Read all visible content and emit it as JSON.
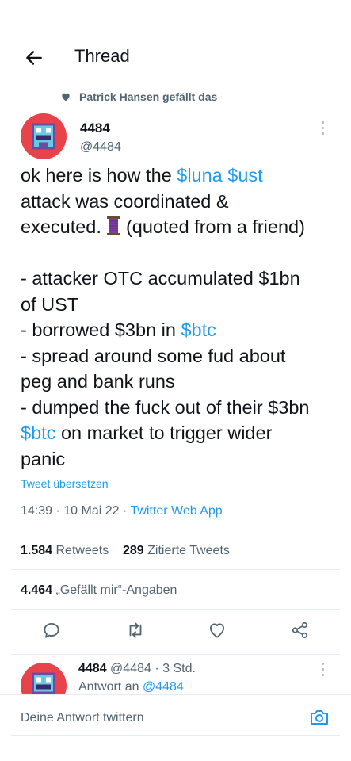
{
  "header": {
    "title": "Thread",
    "back_icon": "arrow-left-icon"
  },
  "social_context": {
    "text": "Patrick Hansen gefällt das",
    "icon": "heart-icon"
  },
  "tweet": {
    "author_name": "4484",
    "author_handle": "@4484",
    "text_segments": [
      "ok here is how the ",
      "$luna",
      " ",
      "$ust",
      "\nattack was coordinated &\nexecuted. ",
      " (quoted from a friend)\n\n- attacker OTC accumulated $1bn\nof UST\n- borrowed $3bn in ",
      "$btc",
      "\n- spread around some fud about\npeg and bank runs\n- dumped the fuck out of their $3bn\n",
      "$btc",
      " on market to trigger wider\npanic"
    ],
    "translate_label": "Tweet übersetzen",
    "time": "14:39",
    "date": "10 Mai 22",
    "source": "Twitter Web App",
    "retweets_count": "1.584",
    "retweets_label": "Retweets",
    "quotes_count": "289",
    "quotes_label": "Zitierte Tweets",
    "likes_count": "4.464",
    "likes_label": "„Gefällt mir“-Angaben"
  },
  "reply": {
    "author_name": "4484",
    "author_handle": "@4484",
    "time": "3 Std.",
    "reply_to_label": "Antwort an",
    "reply_to_handle": "@4484"
  },
  "composer": {
    "placeholder": "Deine Antwort twittern",
    "icon": "camera-icon"
  },
  "colors": {
    "link": "#1d9bf0",
    "avatar": "#e8424a",
    "text": "#0f1419",
    "muted": "#536471"
  }
}
